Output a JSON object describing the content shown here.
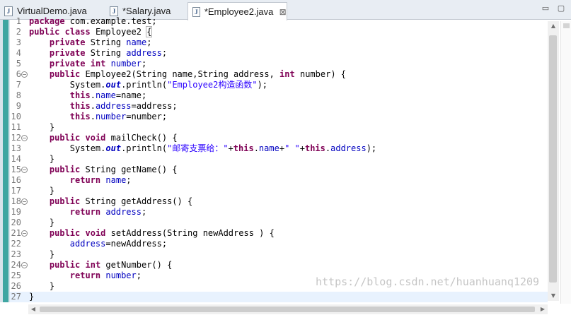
{
  "tabs": [
    {
      "label": "VirtualDemo.java",
      "active": false,
      "closable": false
    },
    {
      "label": "*Salary.java",
      "active": false,
      "closable": false
    },
    {
      "label": "*Employee2.java",
      "active": true,
      "closable": true
    }
  ],
  "tab_icon_glyph": "J",
  "tab_close_glyph": "⊠",
  "window_controls": {
    "minimize": "▭",
    "maximize": "▢"
  },
  "editor": {
    "current_line": 27,
    "lines": [
      {
        "n": "1",
        "fold": false,
        "tokens": [
          [
            "kw",
            "package"
          ],
          [
            "p",
            " com.example.test;"
          ]
        ]
      },
      {
        "n": "2",
        "fold": false,
        "tokens": [
          [
            "kw",
            "public"
          ],
          [
            "p",
            " "
          ],
          [
            "kw",
            "class"
          ],
          [
            "p",
            " Employee2 "
          ],
          [
            "brace",
            "{"
          ]
        ]
      },
      {
        "n": "3",
        "fold": false,
        "tokens": [
          [
            "p",
            "    "
          ],
          [
            "kw",
            "private"
          ],
          [
            "p",
            " String "
          ],
          [
            "fld",
            "name"
          ],
          [
            "p",
            ";"
          ]
        ]
      },
      {
        "n": "4",
        "fold": false,
        "tokens": [
          [
            "p",
            "    "
          ],
          [
            "kw",
            "private"
          ],
          [
            "p",
            " String "
          ],
          [
            "fld",
            "address"
          ],
          [
            "p",
            ";"
          ]
        ]
      },
      {
        "n": "5",
        "fold": false,
        "tokens": [
          [
            "p",
            "    "
          ],
          [
            "kw",
            "private"
          ],
          [
            "p",
            " "
          ],
          [
            "kw",
            "int"
          ],
          [
            "p",
            " "
          ],
          [
            "fld",
            "number"
          ],
          [
            "p",
            ";"
          ]
        ]
      },
      {
        "n": "6",
        "fold": true,
        "tokens": [
          [
            "p",
            "    "
          ],
          [
            "kw",
            "public"
          ],
          [
            "p",
            " Employee2(String "
          ],
          [
            "p",
            "name"
          ],
          [
            "p",
            ",String "
          ],
          [
            "p",
            "address"
          ],
          [
            "p",
            ", "
          ],
          [
            "kw",
            "int"
          ],
          [
            "p",
            " "
          ],
          [
            "p",
            "number"
          ],
          [
            "p",
            ") {"
          ]
        ]
      },
      {
        "n": "7",
        "fold": false,
        "tokens": [
          [
            "p",
            "        System."
          ],
          [
            "st",
            "out"
          ],
          [
            "p",
            ".println("
          ],
          [
            "str",
            "\"Employee2构造函数\""
          ],
          [
            "p",
            ");"
          ]
        ]
      },
      {
        "n": "8",
        "fold": false,
        "tokens": [
          [
            "p",
            "        "
          ],
          [
            "kw",
            "this"
          ],
          [
            "p",
            "."
          ],
          [
            "fld",
            "name"
          ],
          [
            "p",
            "=name;"
          ]
        ]
      },
      {
        "n": "9",
        "fold": false,
        "tokens": [
          [
            "p",
            "        "
          ],
          [
            "kw",
            "this"
          ],
          [
            "p",
            "."
          ],
          [
            "fld",
            "address"
          ],
          [
            "p",
            "=address;"
          ]
        ]
      },
      {
        "n": "10",
        "fold": false,
        "tokens": [
          [
            "p",
            "        "
          ],
          [
            "kw",
            "this"
          ],
          [
            "p",
            "."
          ],
          [
            "fld",
            "number"
          ],
          [
            "p",
            "=number;"
          ]
        ]
      },
      {
        "n": "11",
        "fold": false,
        "tokens": [
          [
            "p",
            "    }"
          ]
        ]
      },
      {
        "n": "12",
        "fold": true,
        "tokens": [
          [
            "p",
            "    "
          ],
          [
            "kw",
            "public"
          ],
          [
            "p",
            " "
          ],
          [
            "kw",
            "void"
          ],
          [
            "p",
            " mailCheck() {"
          ]
        ]
      },
      {
        "n": "13",
        "fold": false,
        "tokens": [
          [
            "p",
            "        System."
          ],
          [
            "st",
            "out"
          ],
          [
            "p",
            ".println("
          ],
          [
            "str",
            "\"邮寄支票给：\""
          ],
          [
            "p",
            "+"
          ],
          [
            "kw",
            "this"
          ],
          [
            "p",
            "."
          ],
          [
            "fld",
            "name"
          ],
          [
            "p",
            "+"
          ],
          [
            "str",
            "\" \""
          ],
          [
            "p",
            "+"
          ],
          [
            "kw",
            "this"
          ],
          [
            "p",
            "."
          ],
          [
            "fld",
            "address"
          ],
          [
            "p",
            ");"
          ]
        ]
      },
      {
        "n": "14",
        "fold": false,
        "tokens": [
          [
            "p",
            "    }"
          ]
        ]
      },
      {
        "n": "15",
        "fold": true,
        "tokens": [
          [
            "p",
            "    "
          ],
          [
            "kw",
            "public"
          ],
          [
            "p",
            " String getName() {"
          ]
        ]
      },
      {
        "n": "16",
        "fold": false,
        "tokens": [
          [
            "p",
            "        "
          ],
          [
            "kw",
            "return"
          ],
          [
            "p",
            " "
          ],
          [
            "fld",
            "name"
          ],
          [
            "p",
            ";"
          ]
        ]
      },
      {
        "n": "17",
        "fold": false,
        "tokens": [
          [
            "p",
            "    }"
          ]
        ]
      },
      {
        "n": "18",
        "fold": true,
        "tokens": [
          [
            "p",
            "    "
          ],
          [
            "kw",
            "public"
          ],
          [
            "p",
            " String getAddress() {"
          ]
        ]
      },
      {
        "n": "19",
        "fold": false,
        "tokens": [
          [
            "p",
            "        "
          ],
          [
            "kw",
            "return"
          ],
          [
            "p",
            " "
          ],
          [
            "fld",
            "address"
          ],
          [
            "p",
            ";"
          ]
        ]
      },
      {
        "n": "20",
        "fold": false,
        "tokens": [
          [
            "p",
            "    }"
          ]
        ]
      },
      {
        "n": "21",
        "fold": true,
        "tokens": [
          [
            "p",
            "    "
          ],
          [
            "kw",
            "public"
          ],
          [
            "p",
            " "
          ],
          [
            "kw",
            "void"
          ],
          [
            "p",
            " setAddress(String "
          ],
          [
            "p",
            "newAddress"
          ],
          [
            "p",
            " ) {"
          ]
        ]
      },
      {
        "n": "22",
        "fold": false,
        "tokens": [
          [
            "p",
            "        "
          ],
          [
            "fld",
            "address"
          ],
          [
            "p",
            "="
          ],
          [
            "p",
            "newAddress"
          ],
          [
            "p",
            ";"
          ]
        ]
      },
      {
        "n": "23",
        "fold": false,
        "tokens": [
          [
            "p",
            "    }"
          ]
        ]
      },
      {
        "n": "24",
        "fold": true,
        "tokens": [
          [
            "p",
            "    "
          ],
          [
            "kw",
            "public"
          ],
          [
            "p",
            " "
          ],
          [
            "kw",
            "int"
          ],
          [
            "p",
            " getNumber() {"
          ]
        ]
      },
      {
        "n": "25",
        "fold": false,
        "tokens": [
          [
            "p",
            "        "
          ],
          [
            "kw",
            "return"
          ],
          [
            "p",
            " "
          ],
          [
            "fld",
            "number"
          ],
          [
            "p",
            ";"
          ]
        ]
      },
      {
        "n": "26",
        "fold": false,
        "tokens": [
          [
            "p",
            "    }"
          ]
        ]
      },
      {
        "n": "27",
        "fold": false,
        "tokens": [
          [
            "p",
            "}"
          ]
        ]
      }
    ]
  },
  "watermark": "https://blog.csdn.net/huanhuanq1209",
  "colors": {
    "keyword": "#7f0055",
    "field": "#0000c0",
    "string": "#2a00ff",
    "change_marker": "#3fa6a2",
    "current_line": "#e8f2fe"
  }
}
